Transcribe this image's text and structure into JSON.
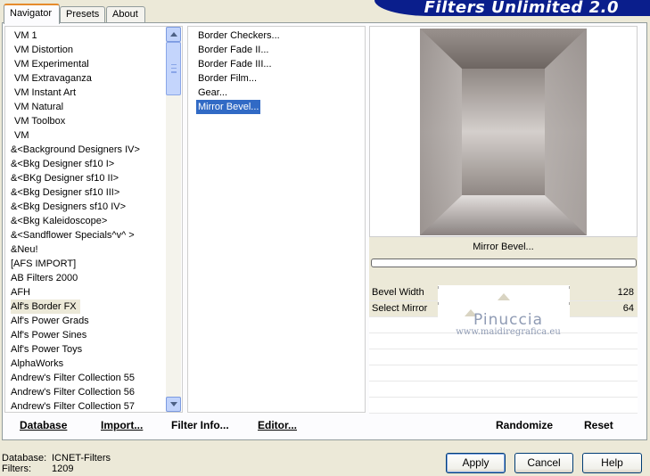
{
  "tabs": [
    "Navigator",
    "Presets",
    "About"
  ],
  "active_tab": "Navigator",
  "banner_title": "Filters Unlimited 2.0",
  "categories": [
    "VM 1",
    "VM Distortion",
    "VM Experimental",
    "VM Extravaganza",
    "VM Instant Art",
    "VM Natural",
    "VM Toolbox",
    "VM",
    "&<Background Designers IV>",
    "&<Bkg Designer sf10 I>",
    "&<BKg Designer sf10 II>",
    "&<Bkg Designer sf10 III>",
    "&<Bkg Designers sf10 IV>",
    "&<Bkg Kaleidoscope>",
    "&<Sandflower Specials^v^ >",
    "&Neu!",
    "[AFS IMPORT]",
    "AB Filters 2000",
    "AFH",
    "Alf's Border FX",
    "Alf's Power Grads",
    "Alf's Power Sines",
    "Alf's Power Toys",
    "AlphaWorks",
    "Andrew's Filter Collection 55",
    "Andrew's Filter Collection 56",
    "Andrew's Filter Collection 57"
  ],
  "selected_category": "Alf's Border FX",
  "filters": [
    "Border Checkers...",
    "Border Fade II...",
    "Border Fade III...",
    "Border Film...",
    "Gear...",
    "Mirror Bevel..."
  ],
  "selected_filter": "Mirror Bevel...",
  "current_filter_name": "Mirror Bevel...",
  "params": [
    {
      "label": "Bevel Width",
      "value": "128",
      "fraction": 0.5
    },
    {
      "label": "Select Mirror",
      "value": "64",
      "fraction": 0.25
    }
  ],
  "watermark": {
    "line1": "Pinuccia",
    "line2": "www.maidiregrafica.eu"
  },
  "left_actions": {
    "database": "Database",
    "import": "Import...",
    "filter_info": "Filter Info...",
    "editor": "Editor..."
  },
  "right_actions": {
    "randomize": "Randomize",
    "reset": "Reset"
  },
  "status": {
    "database_label": "Database:",
    "database_value": "ICNET-Filters",
    "filters_label": "Filters:",
    "filters_value": "1209"
  },
  "buttons": {
    "apply": "Apply",
    "cancel": "Cancel",
    "help": "Help"
  },
  "colors": {
    "selection_blue": "#316ac5",
    "banner": "#0a1e8c",
    "tab_accent": "#e68b2c"
  }
}
